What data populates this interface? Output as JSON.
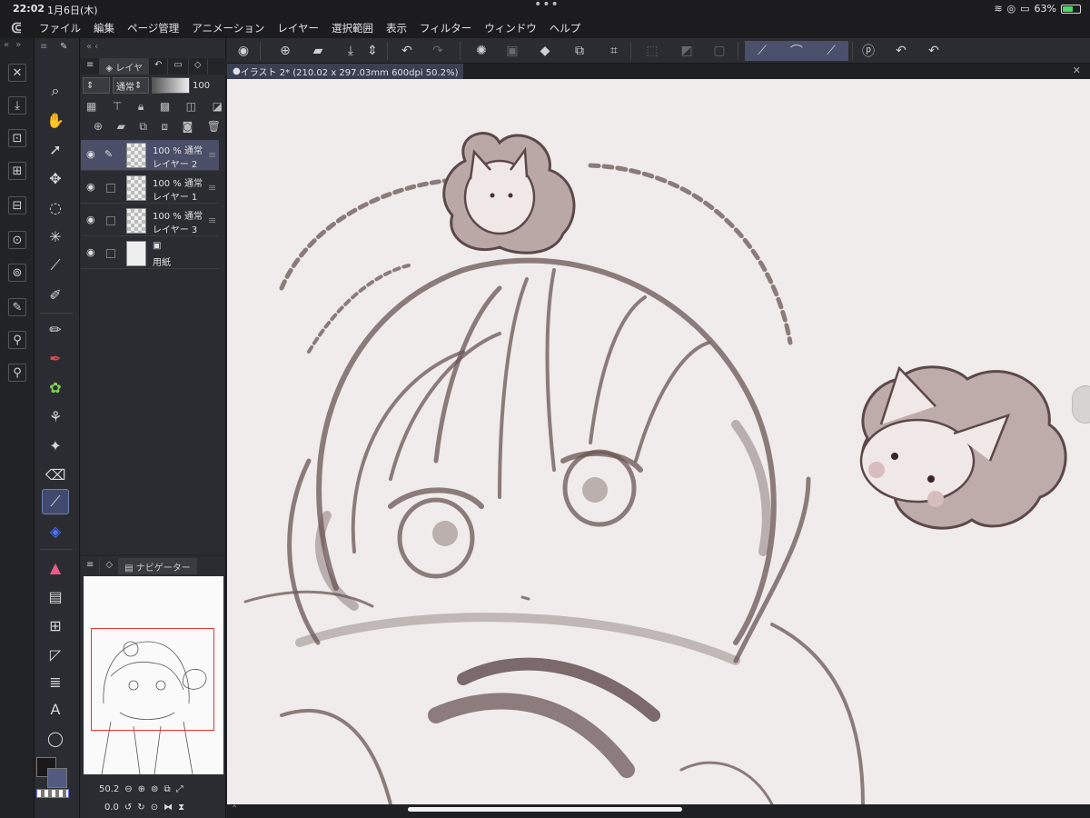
{
  "status": {
    "time": "22:02",
    "date": "1月6日(木)",
    "dots": "•••",
    "battery": "63%",
    "battery_level": 0.63
  },
  "menu": [
    "ファイル",
    "編集",
    "ページ管理",
    "アニメーション",
    "レイヤー",
    "選択範囲",
    "表示",
    "フィルター",
    "ウィンドウ",
    "ヘルプ"
  ],
  "layer_panel": {
    "tab_label": "レイヤ",
    "blend_mode": "通常",
    "opacity": "100",
    "layers": [
      {
        "opacity_mode": "100 % 通常",
        "name": "レイヤー 2",
        "selected": true
      },
      {
        "opacity_mode": "100 % 通常",
        "name": "レイヤー 1",
        "selected": false
      },
      {
        "opacity_mode": "100 % 通常",
        "name": "レイヤー 3",
        "selected": false
      },
      {
        "opacity_mode": "",
        "name": "用紙",
        "selected": false
      }
    ]
  },
  "navigator": {
    "tab_label": "ナビゲーター",
    "zoom": "50.2",
    "rotation": "0.0"
  },
  "document": {
    "tab_label": "イラスト 2* (210.02 x 297.03mm 600dpi 50.2%)"
  },
  "colors": {
    "main": "#1a1718",
    "sub": "#525a82",
    "accent": "#4a4f6b"
  }
}
